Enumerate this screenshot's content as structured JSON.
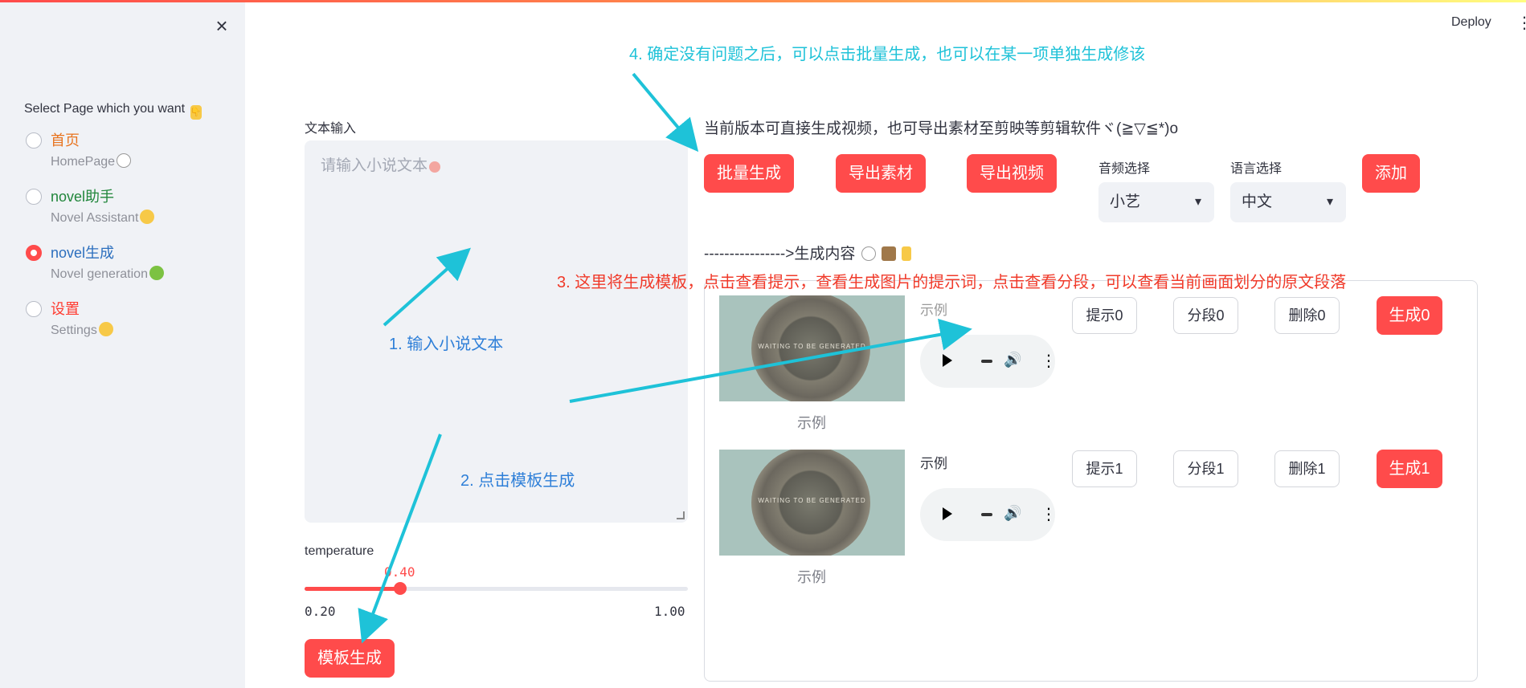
{
  "sidebar": {
    "heading": "Select Page which you want",
    "items": [
      {
        "label": "首页",
        "sub": "HomePage",
        "checked": false,
        "label_color": "#e8741f"
      },
      {
        "label": "novel助手",
        "sub": "Novel Assistant",
        "checked": false,
        "label_color": "#21863b"
      },
      {
        "label": "novel生成",
        "sub": "Novel generation",
        "checked": true,
        "label_color": "#2c6fbe"
      },
      {
        "label": "设置",
        "sub": "Settings",
        "checked": false,
        "label_color": "#ff3b30"
      }
    ]
  },
  "header": {
    "deploy_label": "Deploy"
  },
  "left": {
    "text_input_label": "文本输入",
    "text_input_placeholder": "请输入小说文本",
    "temperature_label": "temperature",
    "temperature_value": "0.40",
    "temperature_min": "0.20",
    "temperature_max": "1.00",
    "temperature_fraction": 0.25,
    "template_button": "模板生成"
  },
  "right": {
    "intro_text": "当前版本可直接生成视频，也可导出素材至剪映等剪辑软件ヾ(≧▽≦*)o",
    "batch_button": "批量生成",
    "export_material_button": "导出素材",
    "export_video_button": "导出视频",
    "audio_select_label": "音频选择",
    "audio_select_value": "小艺",
    "language_select_label": "语言选择",
    "language_select_value": "中文",
    "add_button": "添加",
    "content_heading": "---------------->生成内容",
    "items": [
      {
        "caption": "示例",
        "audio_caption": "示例",
        "prompt_btn": "提示0",
        "segment_btn": "分段0",
        "delete_btn": "删除0",
        "generate_btn": "生成0",
        "thumb_text": "WAITING TO BE GENERATED"
      },
      {
        "caption": "示例",
        "audio_caption": "示例",
        "prompt_btn": "提示1",
        "segment_btn": "分段1",
        "delete_btn": "删除1",
        "generate_btn": "生成1",
        "thumb_text": "WAITING TO BE GENERATED"
      }
    ]
  },
  "annotations": {
    "step1": "1. 输入小说文本",
    "step2": "2. 点击模板生成",
    "step3": "3. 这里将生成模板，点击查看提示，查看生成图片的提示词，点击查看分段，可以查看当前画面划分的原文段落",
    "step4": "4. 确定没有问题之后，可以点击批量生成，也可以在某一项单独生成修该"
  },
  "colors": {
    "accent": "#ff4b4b",
    "sidebar_bg": "#f0f2f6",
    "annotation_cyan": "#1ec2d8",
    "annotation_blue": "#2e7fd8",
    "annotation_red": "#f03a2a"
  }
}
